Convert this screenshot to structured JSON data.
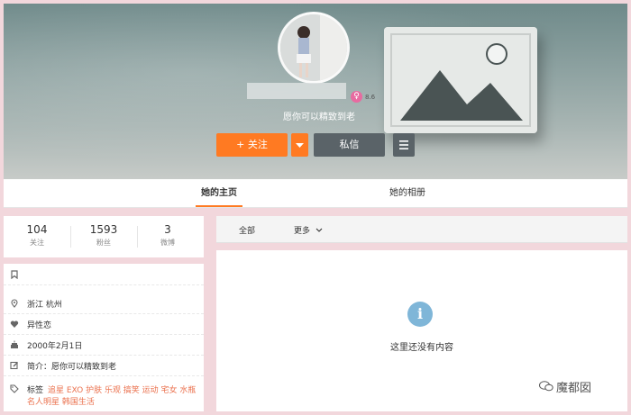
{
  "profile": {
    "bio": "愿你可以精致到老",
    "badge_text": "8.6"
  },
  "actions": {
    "follow_label": "+ 关注",
    "message_label": "私信"
  },
  "tabs": {
    "home": "她的主页",
    "album": "她的相册"
  },
  "stats": [
    {
      "value": "104",
      "label": "关注"
    },
    {
      "value": "1593",
      "label": "粉丝"
    },
    {
      "value": "3",
      "label": "微博"
    }
  ],
  "info": {
    "location": "浙江 杭州",
    "orientation": "异性恋",
    "birthday": "2000年2月1日",
    "intro": "简介：愿你可以精致到老",
    "tags_label": "标签",
    "tags_line1": "追星 EXO 护肤 乐观 搞笑 运动 宅女 水瓶",
    "tags_line2": "名人明星 韩国生活"
  },
  "filter": {
    "all": "全部",
    "more": "更多"
  },
  "empty_state": "这里还没有内容",
  "watermark": "魔都囡",
  "colors": {
    "accent_orange": "#ff7a22",
    "dark_button": "#5a6368",
    "tag_color": "#eb7350",
    "info_icon": "#7fb6d8",
    "page_bg": "#f2d7dc"
  }
}
